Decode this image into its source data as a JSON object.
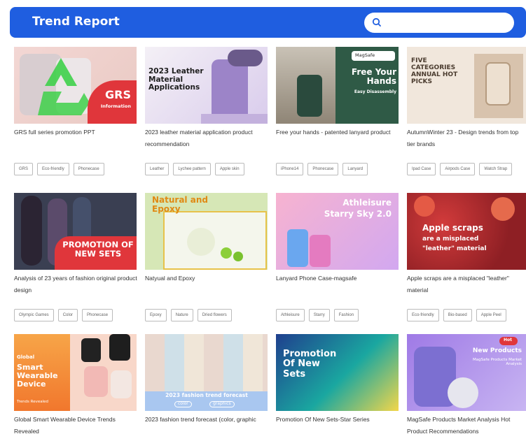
{
  "header": {
    "title": "Trend Report",
    "search_placeholder": ""
  },
  "cards": [
    {
      "title": "GRS full series promotion PPT",
      "thumb_text": [
        "GRS",
        "Information"
      ],
      "tags": [
        "GRS",
        "Eco-friendly",
        "Phonecase"
      ]
    },
    {
      "title": "2023 leather material application product recommendation",
      "thumb_text": [
        "2023 Leather Material Applications"
      ],
      "tags": [
        "Leather",
        "Lychee pattern",
        "Apple skin"
      ]
    },
    {
      "title": "Free your hands - patented lanyard product",
      "thumb_text": [
        "Free Your Hands",
        "Easy Disassembly",
        "MagSafe"
      ],
      "tags": [
        "iPhone14",
        "Phonecase",
        "Lanyard"
      ]
    },
    {
      "title": "AutumnWinter 23 - Design trends from top tier brands",
      "thumb_text": [
        "FIVE CATEGORIES ANNUAL HOT PICKS"
      ],
      "tags": [
        "Ipad Case",
        "Airpods Case",
        "Watch Strap"
      ]
    },
    {
      "title": "Analysis of 23 years of fashion original product design",
      "thumb_text": [
        "PROMOTION OF NEW SETS"
      ],
      "tags": [
        "Olympic Games",
        "Color",
        "Phonecase"
      ]
    },
    {
      "title": "Natyual and Epoxy",
      "thumb_text": [
        "Natural and Epoxy"
      ],
      "tags": [
        "Epoxy",
        "Nature",
        "Dried flowers"
      ]
    },
    {
      "title": "Lanyard Phone Case-magsafe",
      "thumb_text": [
        "Athleisure",
        "Starry Sky 2.0"
      ],
      "tags": [
        "Athleisure",
        "Starry",
        "Fashion"
      ]
    },
    {
      "title": "Apple scraps are a misplaced \"leather\" material",
      "thumb_text": [
        "Apple scraps",
        "are a misplaced",
        "\"leather\" material"
      ],
      "tags": [
        "Eco-friendly",
        "Bio-based",
        "Apple Peel"
      ]
    },
    {
      "title": "Global Smart Wearable Device Trends Revealed",
      "thumb_text": [
        "Global",
        "Smart Wearable Device",
        "Trends Revealed"
      ],
      "tags": []
    },
    {
      "title": "2023 fashion trend forecast (color, graphic",
      "thumb_text": [
        "2023 fashion trend forecast",
        "color",
        "graphics"
      ],
      "tags": []
    },
    {
      "title": "Promotion Of New Sets-Star Series",
      "thumb_text": [
        "Promotion Of New Sets"
      ],
      "tags": []
    },
    {
      "title": "MagSafe Products Market Analysis Hot Product Recommendations",
      "thumb_text": [
        "Hot",
        "New Products",
        "MagSafe Products Market Analysis"
      ],
      "tags": []
    }
  ],
  "colors": {
    "header_bg": "#1f5ee0",
    "accent_red": "#e0363b"
  }
}
